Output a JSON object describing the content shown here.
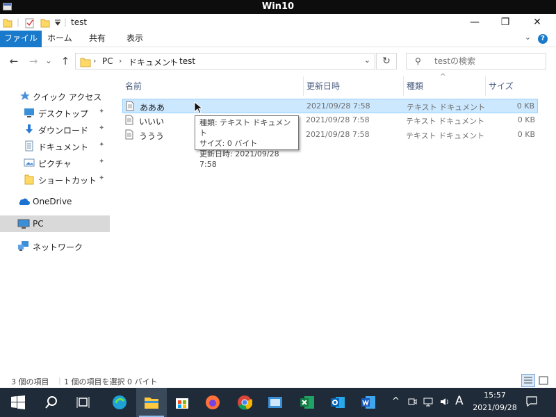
{
  "vm": {
    "title": "Win10"
  },
  "window": {
    "title": "test",
    "minimize": "—",
    "maximize": "❐",
    "close": "✕"
  },
  "ribbon": {
    "tabs": [
      {
        "label": "ファイル"
      },
      {
        "label": "ホーム"
      },
      {
        "label": "共有"
      },
      {
        "label": "表示"
      }
    ],
    "help": "?",
    "expand": "⌄"
  },
  "nav": {
    "back": "←",
    "forward": "→",
    "recent": "⌄",
    "up": "↑",
    "breadcrumb": [
      "PC",
      "ドキュメント",
      "test"
    ],
    "crumb_sep": "›",
    "dropdown": "⌄",
    "refresh": "↻",
    "search_placeholder": "testの検索"
  },
  "sidebar": {
    "items": [
      {
        "label": "クイック アクセス",
        "icon": "star-icon"
      },
      {
        "label": "デスクトップ",
        "icon": "desktop-icon",
        "pinned": true
      },
      {
        "label": "ダウンロード",
        "icon": "download-icon",
        "pinned": true
      },
      {
        "label": "ドキュメント",
        "icon": "document-icon",
        "pinned": true
      },
      {
        "label": "ピクチャ",
        "icon": "pictures-icon",
        "pinned": true
      },
      {
        "label": "ショートカット",
        "icon": "folder-icon",
        "pinned": true
      },
      {
        "label": "OneDrive",
        "icon": "cloud-icon"
      },
      {
        "label": "PC",
        "icon": "pc-icon",
        "selected": true
      },
      {
        "label": "ネットワーク",
        "icon": "network-icon"
      }
    ],
    "pin_glyph": "📌"
  },
  "columns": {
    "name": "名前",
    "date": "更新日時",
    "type": "種類",
    "size": "サイズ",
    "sort_glyph": "^"
  },
  "files": [
    {
      "name": "あああ",
      "date": "2021/09/28 7:58",
      "type": "テキスト ドキュメント",
      "size": "0 KB",
      "selected": true
    },
    {
      "name": "いいい",
      "date": "2021/09/28 7:58",
      "type": "テキスト ドキュメント",
      "size": "0 KB"
    },
    {
      "name": "ううう",
      "date": "2021/09/28 7:58",
      "type": "テキスト ドキュメント",
      "size": "0 KB"
    }
  ],
  "tooltip": {
    "line1": "種類: テキスト ドキュメント",
    "line2": "サイズ: 0 バイト",
    "line3": "更新日時: 2021/09/28 7:58"
  },
  "status": {
    "count": "3 個の項目",
    "selection": "1 個の項目を選択  0 バイト"
  },
  "taskbar": {
    "ime": "A",
    "clock_time": "15:57",
    "clock_date": "2021/09/28",
    "tray_chevron": "^"
  },
  "colors": {
    "accent": "#1979ca",
    "selection": "#cce8ff",
    "taskbar": "#1f2b38",
    "folder": "#ffd966"
  }
}
